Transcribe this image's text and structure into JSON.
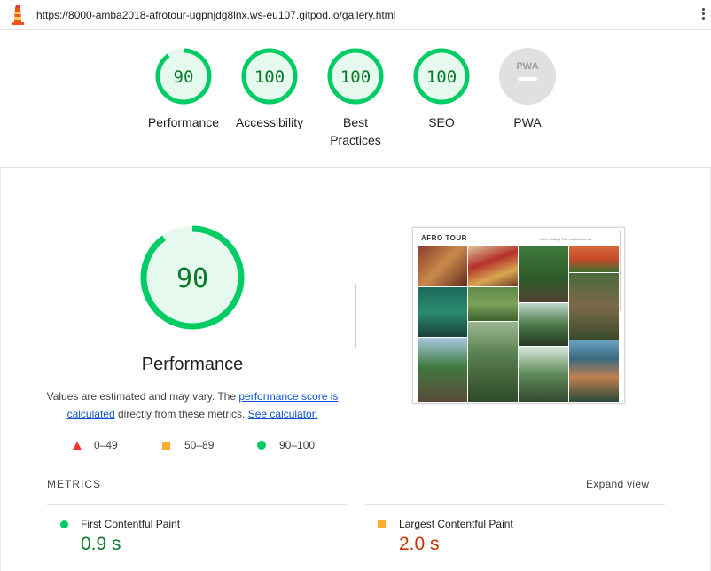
{
  "topbar": {
    "url": "https://8000-amba2018-afrotour-ugpnjdg8lnx.ws-eu107.gitpod.io/gallery.html",
    "logo_icon": "lighthouse-icon",
    "menu_icon": "kebab-menu-icon"
  },
  "gauges": [
    {
      "label": "Performance",
      "score": "90",
      "value": 0.9
    },
    {
      "label": "Accessibility",
      "score": "100",
      "value": 1.0
    },
    {
      "label": "Best Practices",
      "score": "100",
      "value": 1.0
    },
    {
      "label": "SEO",
      "score": "100",
      "value": 1.0
    },
    {
      "label": "PWA",
      "score": "PWA",
      "value": 0
    }
  ],
  "performance": {
    "score": "90",
    "value": 0.9,
    "title": "Performance",
    "desc_1": "Values are estimated and may vary. The ",
    "link_1": "performance score is calculated",
    "desc_2": " directly from these metrics. ",
    "link_2": "See calculator."
  },
  "legend": [
    {
      "range": "0–49",
      "shape": "triangle",
      "color": "#ff3333"
    },
    {
      "range": "50–89",
      "shape": "square",
      "color": "#ffaa33"
    },
    {
      "range": "90–100",
      "shape": "circle",
      "color": "#00cc66"
    }
  ],
  "screenshot": {
    "logo": "AFRO TOUR",
    "nav": "Home  Gallery  Plan us  Contact us"
  },
  "metrics": {
    "title": "METRICS",
    "expand_label": "Expand view",
    "items": [
      {
        "name": "First Contentful Paint",
        "value": "0.9 s",
        "status": "good"
      },
      {
        "name": "Largest Contentful Paint",
        "value": "2.0 s",
        "status": "average"
      }
    ]
  },
  "colors": {
    "good": "#00cc66",
    "good_text": "#0a7a28",
    "good_fill": "#e6f9ee",
    "average": "#ffaa33",
    "average_text": "#c33300",
    "na": "#cccccc",
    "link": "#1155cc"
  }
}
